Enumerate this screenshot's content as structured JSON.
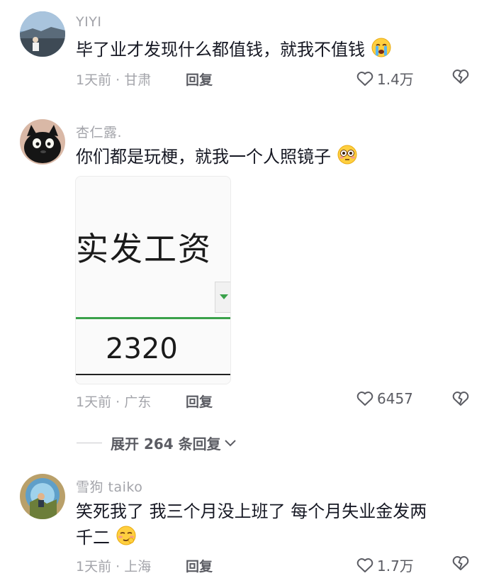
{
  "comments": [
    {
      "author": "YIYI",
      "text": "毕了业才发现什么都值钱，就我不值钱",
      "emoji": "crying-face",
      "time": "1天前",
      "location": "甘肃",
      "reply_label": "回复",
      "likes": "1.4万"
    },
    {
      "author": "杏仁露.",
      "text": "你们都是玩梗，就我一个人照镜子",
      "emoji": "flushed-face",
      "time": "1天前",
      "location": "广东",
      "reply_label": "回复",
      "likes": "6457",
      "image": {
        "heading": "实发工资",
        "amount": "2320"
      }
    },
    {
      "author": "雪狗 taiko",
      "text_line1": "笑死我了 我三个月没上班了 每个月失业金发两",
      "text_line2": "千二",
      "emoji": "smirking-face",
      "time": "1天前",
      "location": "上海",
      "reply_label": "回复",
      "likes": "1.7万"
    }
  ],
  "expand_replies": {
    "label": "展开 264 条回复"
  },
  "colors": {
    "meta_gray": "#a3a4aa",
    "text_dark": "#161823",
    "sheet_green": "#3aa14a"
  }
}
